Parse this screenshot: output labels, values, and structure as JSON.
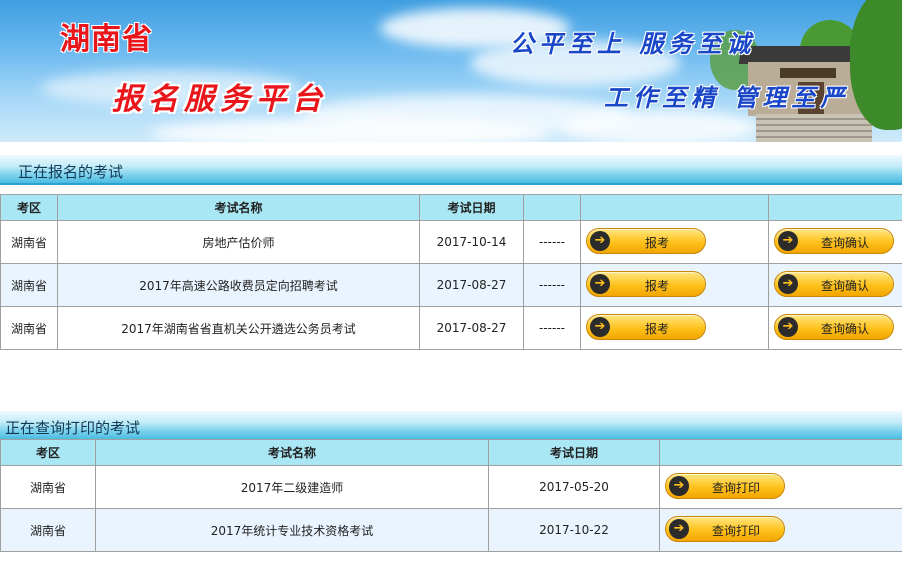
{
  "banner": {
    "province": "湖南省",
    "platform": "报名服务平台",
    "slogan_1": "公平至上 服务至诚",
    "slogan_2": "工作至精 管理至严"
  },
  "registering": {
    "section_title": "正在报名的考试",
    "headers": {
      "region": "考区",
      "exam_name": "考试名称",
      "exam_date": "考试日期"
    },
    "rows": [
      {
        "region": "湖南省",
        "exam_name": "房地产估价师",
        "exam_date": "2017-10-14",
        "extra": "------",
        "register_label": "报考",
        "confirm_label": "查询确认"
      },
      {
        "region": "湖南省",
        "exam_name": "2017年高速公路收费员定向招聘考试",
        "exam_date": "2017-08-27",
        "extra": "------",
        "register_label": "报考",
        "confirm_label": "查询确认"
      },
      {
        "region": "湖南省",
        "exam_name": "2017年湖南省省直机关公开遴选公务员考试",
        "exam_date": "2017-08-27",
        "extra": "------",
        "register_label": "报考",
        "confirm_label": "查询确认"
      }
    ]
  },
  "printing": {
    "section_title": "正在查询打印的考试",
    "headers": {
      "region": "考区",
      "exam_name": "考试名称",
      "exam_date": "考试日期"
    },
    "rows": [
      {
        "region": "湖南省",
        "exam_name": "2017年二级建造师",
        "exam_date": "2017-05-20",
        "print_label": "查询打印"
      },
      {
        "region": "湖南省",
        "exam_name": "2017年统计专业技术资格考试",
        "exam_date": "2017-10-22",
        "print_label": "查询打印"
      }
    ]
  },
  "icons": {
    "button_arrow": "arrow-right-circle-icon"
  },
  "colors": {
    "header_cell": "#a9e7f4",
    "alt_row": "#eaf4ff",
    "button": "#ffc21c",
    "title_red": "#e8151b",
    "slogan_blue": "#1a47c8"
  }
}
